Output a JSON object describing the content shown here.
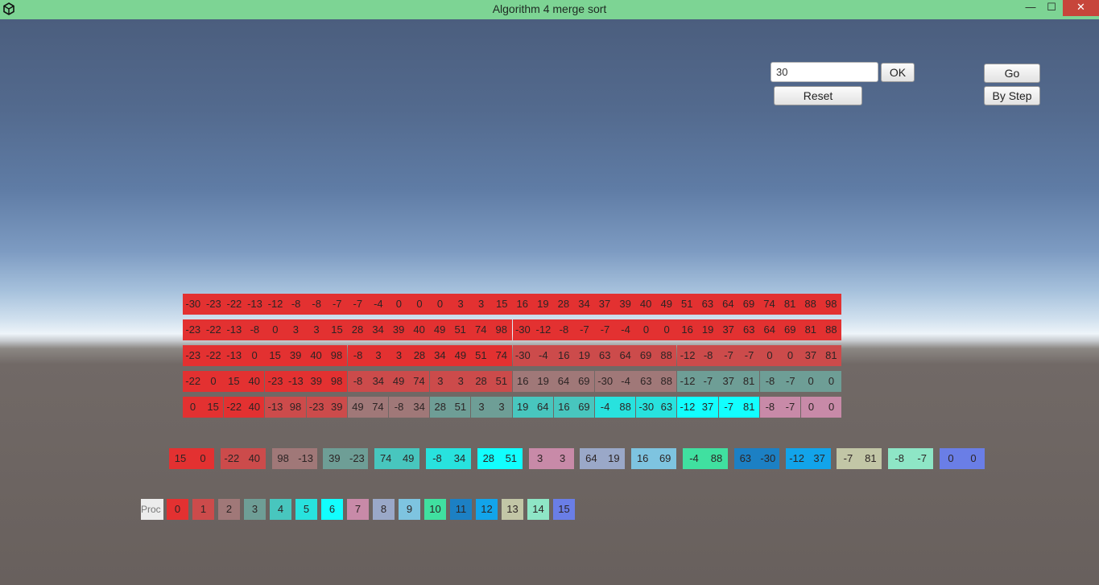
{
  "window": {
    "title": "Algorithm 4 merge sort",
    "controls": [
      "—",
      "☐",
      "✕"
    ]
  },
  "toolbar": {
    "size_input_value": "30",
    "ok_label": "OK",
    "reset_label": "Reset",
    "go_label": "Go",
    "by_step_label": "By Step"
  },
  "colors": {
    "proc": [
      "#e33131",
      "#cc4b4b",
      "#a07878",
      "#6e9e96",
      "#48c6be",
      "#28e2de",
      "#12fefe",
      "#c88aa8",
      "#9aa8c8",
      "#7ec4e0",
      "#40e0a0",
      "#1c80c4",
      "#12a4ea",
      "#c2c6a6",
      "#8ee6c6",
      "#6a7ee6"
    ],
    "merged": "#e33131",
    "proc_label_bg": "#ececec"
  },
  "merge_rows": [
    [
      {
        "values": [
          "-30",
          "-23",
          "-22",
          "-13",
          "-12",
          "-8",
          "-8",
          "-7",
          "-7",
          "-4",
          "0",
          "0",
          "0",
          "3",
          "3",
          "15",
          "16",
          "19",
          "28",
          "34",
          "37",
          "39",
          "40",
          "49",
          "51",
          "63",
          "64",
          "69",
          "74",
          "81",
          "88",
          "98"
        ],
        "proc": 0
      }
    ],
    [
      {
        "values": [
          "-23",
          "-22",
          "-13",
          "-8",
          "0",
          "3",
          "3",
          "15",
          "28",
          "34",
          "39",
          "40",
          "49",
          "51",
          "74",
          "98"
        ],
        "proc": 0
      },
      {
        "values": [
          "-30",
          "-12",
          "-8",
          "-7",
          "-7",
          "-4",
          "0",
          "0",
          "16",
          "19",
          "37",
          "63",
          "64",
          "69",
          "81",
          "88"
        ],
        "proc": 0
      }
    ],
    [
      {
        "values": [
          "-23",
          "-22",
          "-13",
          "0",
          "15",
          "39",
          "40",
          "98"
        ],
        "proc": 0
      },
      {
        "values": [
          "-8",
          "3",
          "3",
          "28",
          "34",
          "49",
          "51",
          "74"
        ],
        "proc": 0
      },
      {
        "values": [
          "-30",
          "-4",
          "16",
          "19",
          "63",
          "64",
          "69",
          "88"
        ],
        "proc": 1
      },
      {
        "values": [
          "-12",
          "-8",
          "-7",
          "-7",
          "0",
          "0",
          "37",
          "81"
        ],
        "proc": 1
      }
    ],
    [
      {
        "values": [
          "-22",
          "0",
          "15",
          "40"
        ],
        "proc": 0
      },
      {
        "values": [
          "-23",
          "-13",
          "39",
          "98"
        ],
        "proc": 0
      },
      {
        "values": [
          "-8",
          "34",
          "49",
          "74"
        ],
        "proc": 1
      },
      {
        "values": [
          "3",
          "3",
          "28",
          "51"
        ],
        "proc": 1
      },
      {
        "values": [
          "16",
          "19",
          "64",
          "69"
        ],
        "proc": 2
      },
      {
        "values": [
          "-30",
          "-4",
          "63",
          "88"
        ],
        "proc": 2
      },
      {
        "values": [
          "-12",
          "-7",
          "37",
          "81"
        ],
        "proc": 3
      },
      {
        "values": [
          "-8",
          "-7",
          "0",
          "0"
        ],
        "proc": 3
      }
    ],
    [
      {
        "values": [
          "0",
          "15"
        ],
        "proc": 0
      },
      {
        "values": [
          "-22",
          "40"
        ],
        "proc": 0
      },
      {
        "values": [
          "-13",
          "98"
        ],
        "proc": 1
      },
      {
        "values": [
          "-23",
          "39"
        ],
        "proc": 1
      },
      {
        "values": [
          "49",
          "74"
        ],
        "proc": 2
      },
      {
        "values": [
          "-8",
          "34"
        ],
        "proc": 2
      },
      {
        "values": [
          "28",
          "51"
        ],
        "proc": 3
      },
      {
        "values": [
          "3",
          "3"
        ],
        "proc": 3
      },
      {
        "values": [
          "19",
          "64"
        ],
        "proc": 4
      },
      {
        "values": [
          "16",
          "69"
        ],
        "proc": 4
      },
      {
        "values": [
          "-4",
          "88"
        ],
        "proc": 5
      },
      {
        "values": [
          "-30",
          "63"
        ],
        "proc": 5
      },
      {
        "values": [
          "-12",
          "37"
        ],
        "proc": 6
      },
      {
        "values": [
          "-7",
          "81"
        ],
        "proc": 6
      },
      {
        "values": [
          "-8",
          "-7"
        ],
        "proc": 7
      },
      {
        "values": [
          "0",
          "0"
        ],
        "proc": 7
      }
    ]
  ],
  "pairs": [
    {
      "values": [
        "15",
        "0"
      ],
      "proc": 0
    },
    {
      "values": [
        "-22",
        "40"
      ],
      "proc": 1
    },
    {
      "values": [
        "98",
        "-13"
      ],
      "proc": 2
    },
    {
      "values": [
        "39",
        "-23"
      ],
      "proc": 3
    },
    {
      "values": [
        "74",
        "49"
      ],
      "proc": 4
    },
    {
      "values": [
        "-8",
        "34"
      ],
      "proc": 5
    },
    {
      "values": [
        "28",
        "51"
      ],
      "proc": 6
    },
    {
      "values": [
        "3",
        "3"
      ],
      "proc": 7
    },
    {
      "values": [
        "64",
        "19"
      ],
      "proc": 8
    },
    {
      "values": [
        "16",
        "69"
      ],
      "proc": 9
    },
    {
      "values": [
        "-4",
        "88"
      ],
      "proc": 10
    },
    {
      "values": [
        "63",
        "-30"
      ],
      "proc": 11
    },
    {
      "values": [
        "-12",
        "37"
      ],
      "proc": 12
    },
    {
      "values": [
        "-7",
        "81"
      ],
      "proc": 13
    },
    {
      "values": [
        "-8",
        "-7"
      ],
      "proc": 14
    },
    {
      "values": [
        "0",
        "0"
      ],
      "proc": 15
    }
  ],
  "legend": {
    "label": "Proc",
    "ids": [
      "0",
      "1",
      "2",
      "3",
      "4",
      "5",
      "6",
      "7",
      "8",
      "9",
      "10",
      "11",
      "12",
      "13",
      "14",
      "15"
    ]
  }
}
